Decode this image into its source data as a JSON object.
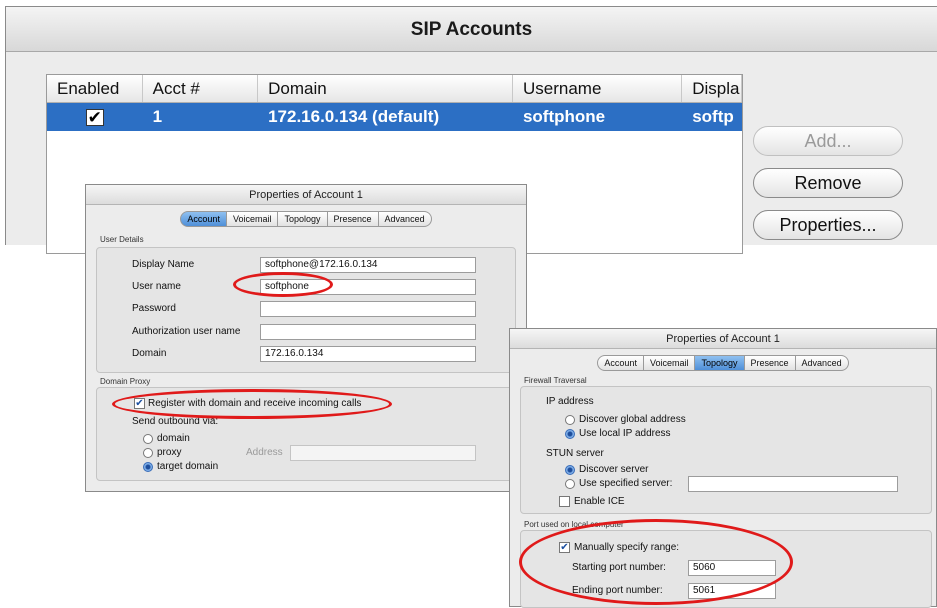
{
  "sip": {
    "title": "SIP Accounts",
    "columns": [
      "Enabled",
      "Acct #",
      "Domain",
      "Username",
      "Displa"
    ],
    "row": {
      "enabled_mark": "☑",
      "acct": "1",
      "domain": "172.16.0.134 (default)",
      "username": "softphone",
      "display": "softp"
    },
    "buttons": {
      "add": "Add...",
      "remove": "Remove",
      "properties": "Properties..."
    }
  },
  "dialog1": {
    "title": "Properties of Account 1",
    "tabs": [
      "Account",
      "Voicemail",
      "Topology",
      "Presence",
      "Advanced"
    ],
    "active_tab": "Account",
    "user_details": {
      "group": "User Details",
      "display_name_label": "Display Name",
      "display_name_value": "softphone@172.16.0.134",
      "user_name_label": "User name",
      "user_name_value": "softphone",
      "password_label": "Password",
      "auth_user_label": "Authorization user name",
      "domain_label": "Domain",
      "domain_value": "172.16.0.134"
    },
    "domain_proxy": {
      "group": "Domain Proxy",
      "register_label": "Register with domain and receive incoming calls",
      "send_outbound_label": "Send outbound via:",
      "options": [
        "domain",
        "proxy",
        "target domain"
      ],
      "address_label": "Address"
    }
  },
  "dialog2": {
    "title": "Properties of Account 1",
    "tabs": [
      "Account",
      "Voicemail",
      "Topology",
      "Presence",
      "Advanced"
    ],
    "active_tab": "Topology",
    "firewall": {
      "group": "Firewall Traversal",
      "ip_label": "IP address",
      "ip_options": [
        "Discover global address",
        "Use local IP address"
      ],
      "stun_label": "STUN server",
      "stun_options": [
        "Discover server",
        "Use specified server:"
      ],
      "enable_ice": "Enable ICE"
    },
    "ports": {
      "group": "Port used on local computer",
      "manual_label": "Manually specify range:",
      "start_label": "Starting port number:",
      "start_value": "5060",
      "end_label": "Ending port number:",
      "end_value": "5061"
    }
  },
  "colors": {
    "selection": "#2c6fc4",
    "annotation": "#e01a1a"
  }
}
